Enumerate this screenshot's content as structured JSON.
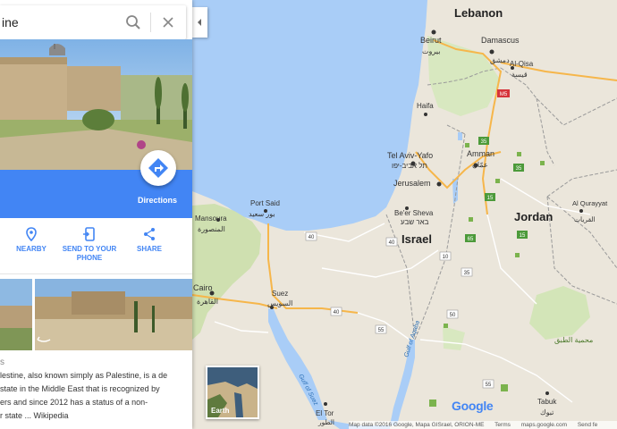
{
  "search": {
    "value": "ine"
  },
  "panel": {
    "directions_label": "Directions",
    "actions": [
      {
        "label_line1": "NEARBY",
        "label_line2": ""
      },
      {
        "label_line1": "SEND TO YOUR",
        "label_line2": "PHONE"
      },
      {
        "label_line1": "SHARE",
        "label_line2": ""
      }
    ],
    "description_star": "s",
    "description_lines": [
      "lestine, also known simply as Palestine, is a de",
      "state in the Middle East that is recognized by",
      "ers and since 2012 has a status of a non-",
      "r state ... Wikipedia"
    ]
  },
  "map": {
    "earth_label": "Earth",
    "google_logo": "Google",
    "footer": [
      "Map data ©2016 Google, Mapa GISrael, ORION-ME",
      "Terms",
      "maps.google.com",
      "Send fe"
    ],
    "countries": [
      {
        "name": "Lebanon"
      },
      {
        "name": "Israel"
      },
      {
        "name": "Jordan"
      }
    ],
    "cities": [
      {
        "name": "Beirut",
        "native": "بيروت"
      },
      {
        "name": "Damascus",
        "native": "دمشق"
      },
      {
        "name": "Al-Qisa",
        "native": "قيسة"
      },
      {
        "name": "Haifa",
        "native": ""
      },
      {
        "name": "Tel Aviv-Yafo",
        "native": "תל אביב-יפו"
      },
      {
        "name": "Amman",
        "native": "عمّان"
      },
      {
        "name": "Jerusalem",
        "native": ""
      },
      {
        "name": "Be'er Sheva",
        "native": "באר שבע"
      },
      {
        "name": "Port Said",
        "native": "بور سعيد"
      },
      {
        "name": "Mansoura",
        "native": "المنصورة"
      },
      {
        "name": "Cairo",
        "native": "القاهرة"
      },
      {
        "name": "Suez",
        "native": "السويس"
      },
      {
        "name": "Al Qurayyat",
        "native": "القريات"
      },
      {
        "name": "Tabuk",
        "native": "تبوك"
      },
      {
        "name": "El Tor",
        "native": "الطور"
      }
    ],
    "regions": [
      {
        "name": "محمية الطبق"
      }
    ],
    "waters": [
      {
        "name": "Gulf of Suez"
      },
      {
        "name": "Gulf of Aqaba"
      }
    ],
    "road_shields": [
      "M5",
      "35",
      "35",
      "15",
      "65",
      "40",
      "40",
      "10",
      "40",
      "55",
      "55",
      "50",
      "15",
      "35"
    ]
  },
  "colors": {
    "accent": "#4285f4",
    "land": "#e8e3d8",
    "sea": "#a3ccff",
    "park": "#c8dfa6",
    "border": "#8c8c8c",
    "highway": "#f9b74a"
  }
}
